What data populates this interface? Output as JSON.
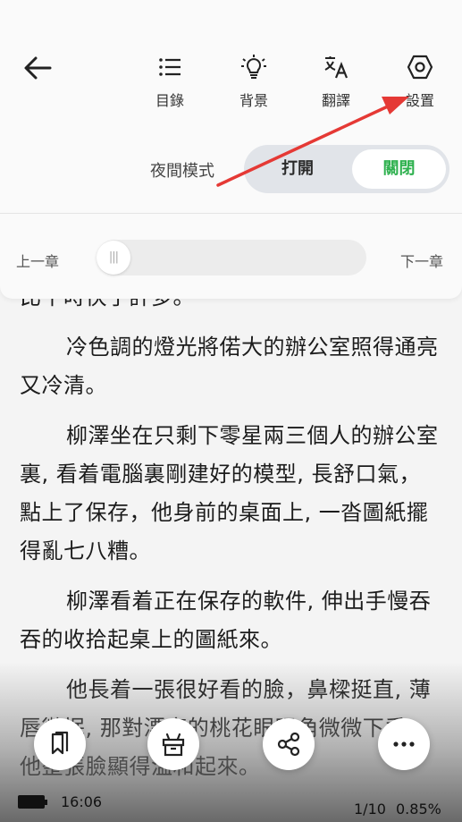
{
  "toolbar": {
    "items": [
      {
        "label": "目錄",
        "icon": "list-icon"
      },
      {
        "label": "背景",
        "icon": "lightbulb-icon"
      },
      {
        "label": "翻譯",
        "icon": "translate-icon"
      },
      {
        "label": "設置",
        "icon": "settings-icon"
      }
    ]
  },
  "night_mode": {
    "label": "夜間模式",
    "on_label": "打開",
    "off_label": "關閉",
    "selected": "關閉",
    "accent": "#2fb14f"
  },
  "chapter_nav": {
    "prev_label": "上一章",
    "next_label": "下一章",
    "progress": 0
  },
  "content": {
    "paragraphs": [
      "比平時快了許多。",
      "冷色調的燈光將偌大的辦公室照得通亮又冷清。",
      "柳澤坐在只剩下零星兩三個人的辦公室裏, 看着電腦裏剛建好的模型, 長舒口氣，點上了保存，他身前的桌面上, 一沓圖紙擺得亂七八糟。",
      "柳澤看着正在保存的軟件, 伸出手慢吞吞的收拾起桌上的圖紙來。",
      "他長着一張很好看的臉，鼻樑挺直, 薄唇微抿, 那對漂亮的桃花眼眼角微微下垂，他整張臉顯得溫和起來。"
    ]
  },
  "fabs": [
    "bookmark-icon",
    "gift-icon",
    "share-icon",
    "more-icon"
  ],
  "footer": {
    "time": "16:06",
    "page": "1/10",
    "percent": "0.85%"
  },
  "colors": {
    "annotation_arrow": "#e53935",
    "background": "#f4f4f4"
  }
}
